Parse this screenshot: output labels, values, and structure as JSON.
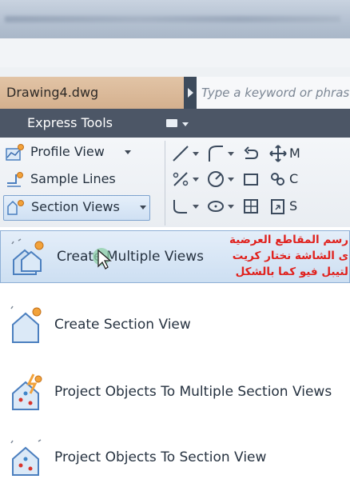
{
  "document": {
    "tab": "Drawing4.dwg",
    "search_placeholder": "Type a keyword or phrase"
  },
  "ribbon": {
    "tab_label": "Express Tools"
  },
  "panel": {
    "commands": [
      {
        "label": "Profile View",
        "has_dropdown": true,
        "icon": "profile-view-icon"
      },
      {
        "label": "Sample Lines",
        "has_dropdown": false,
        "icon": "sample-lines-icon"
      },
      {
        "label": "Section Views",
        "has_dropdown": true,
        "icon": "section-views-icon",
        "selected": true
      }
    ],
    "right_labels": [
      "M",
      "C",
      "S"
    ]
  },
  "dropdown_menu": {
    "items": [
      {
        "label": "Create Multiple Views",
        "icon": "create-multiple-views-icon",
        "highlighted": true
      },
      {
        "label": "Create Section View",
        "icon": "create-section-view-icon"
      },
      {
        "label": "Project Objects To Multiple Section Views",
        "icon": "project-multiple-icon"
      },
      {
        "label": "Project Objects To Section View",
        "icon": "project-section-view-icon"
      }
    ]
  },
  "annotation": {
    "lines": [
      "رسم المقاطع العرضية",
      "ى الشاشة نختار كريت",
      "لتيبل فيو كما بالشكل"
    ],
    "color": "#e0231f"
  }
}
